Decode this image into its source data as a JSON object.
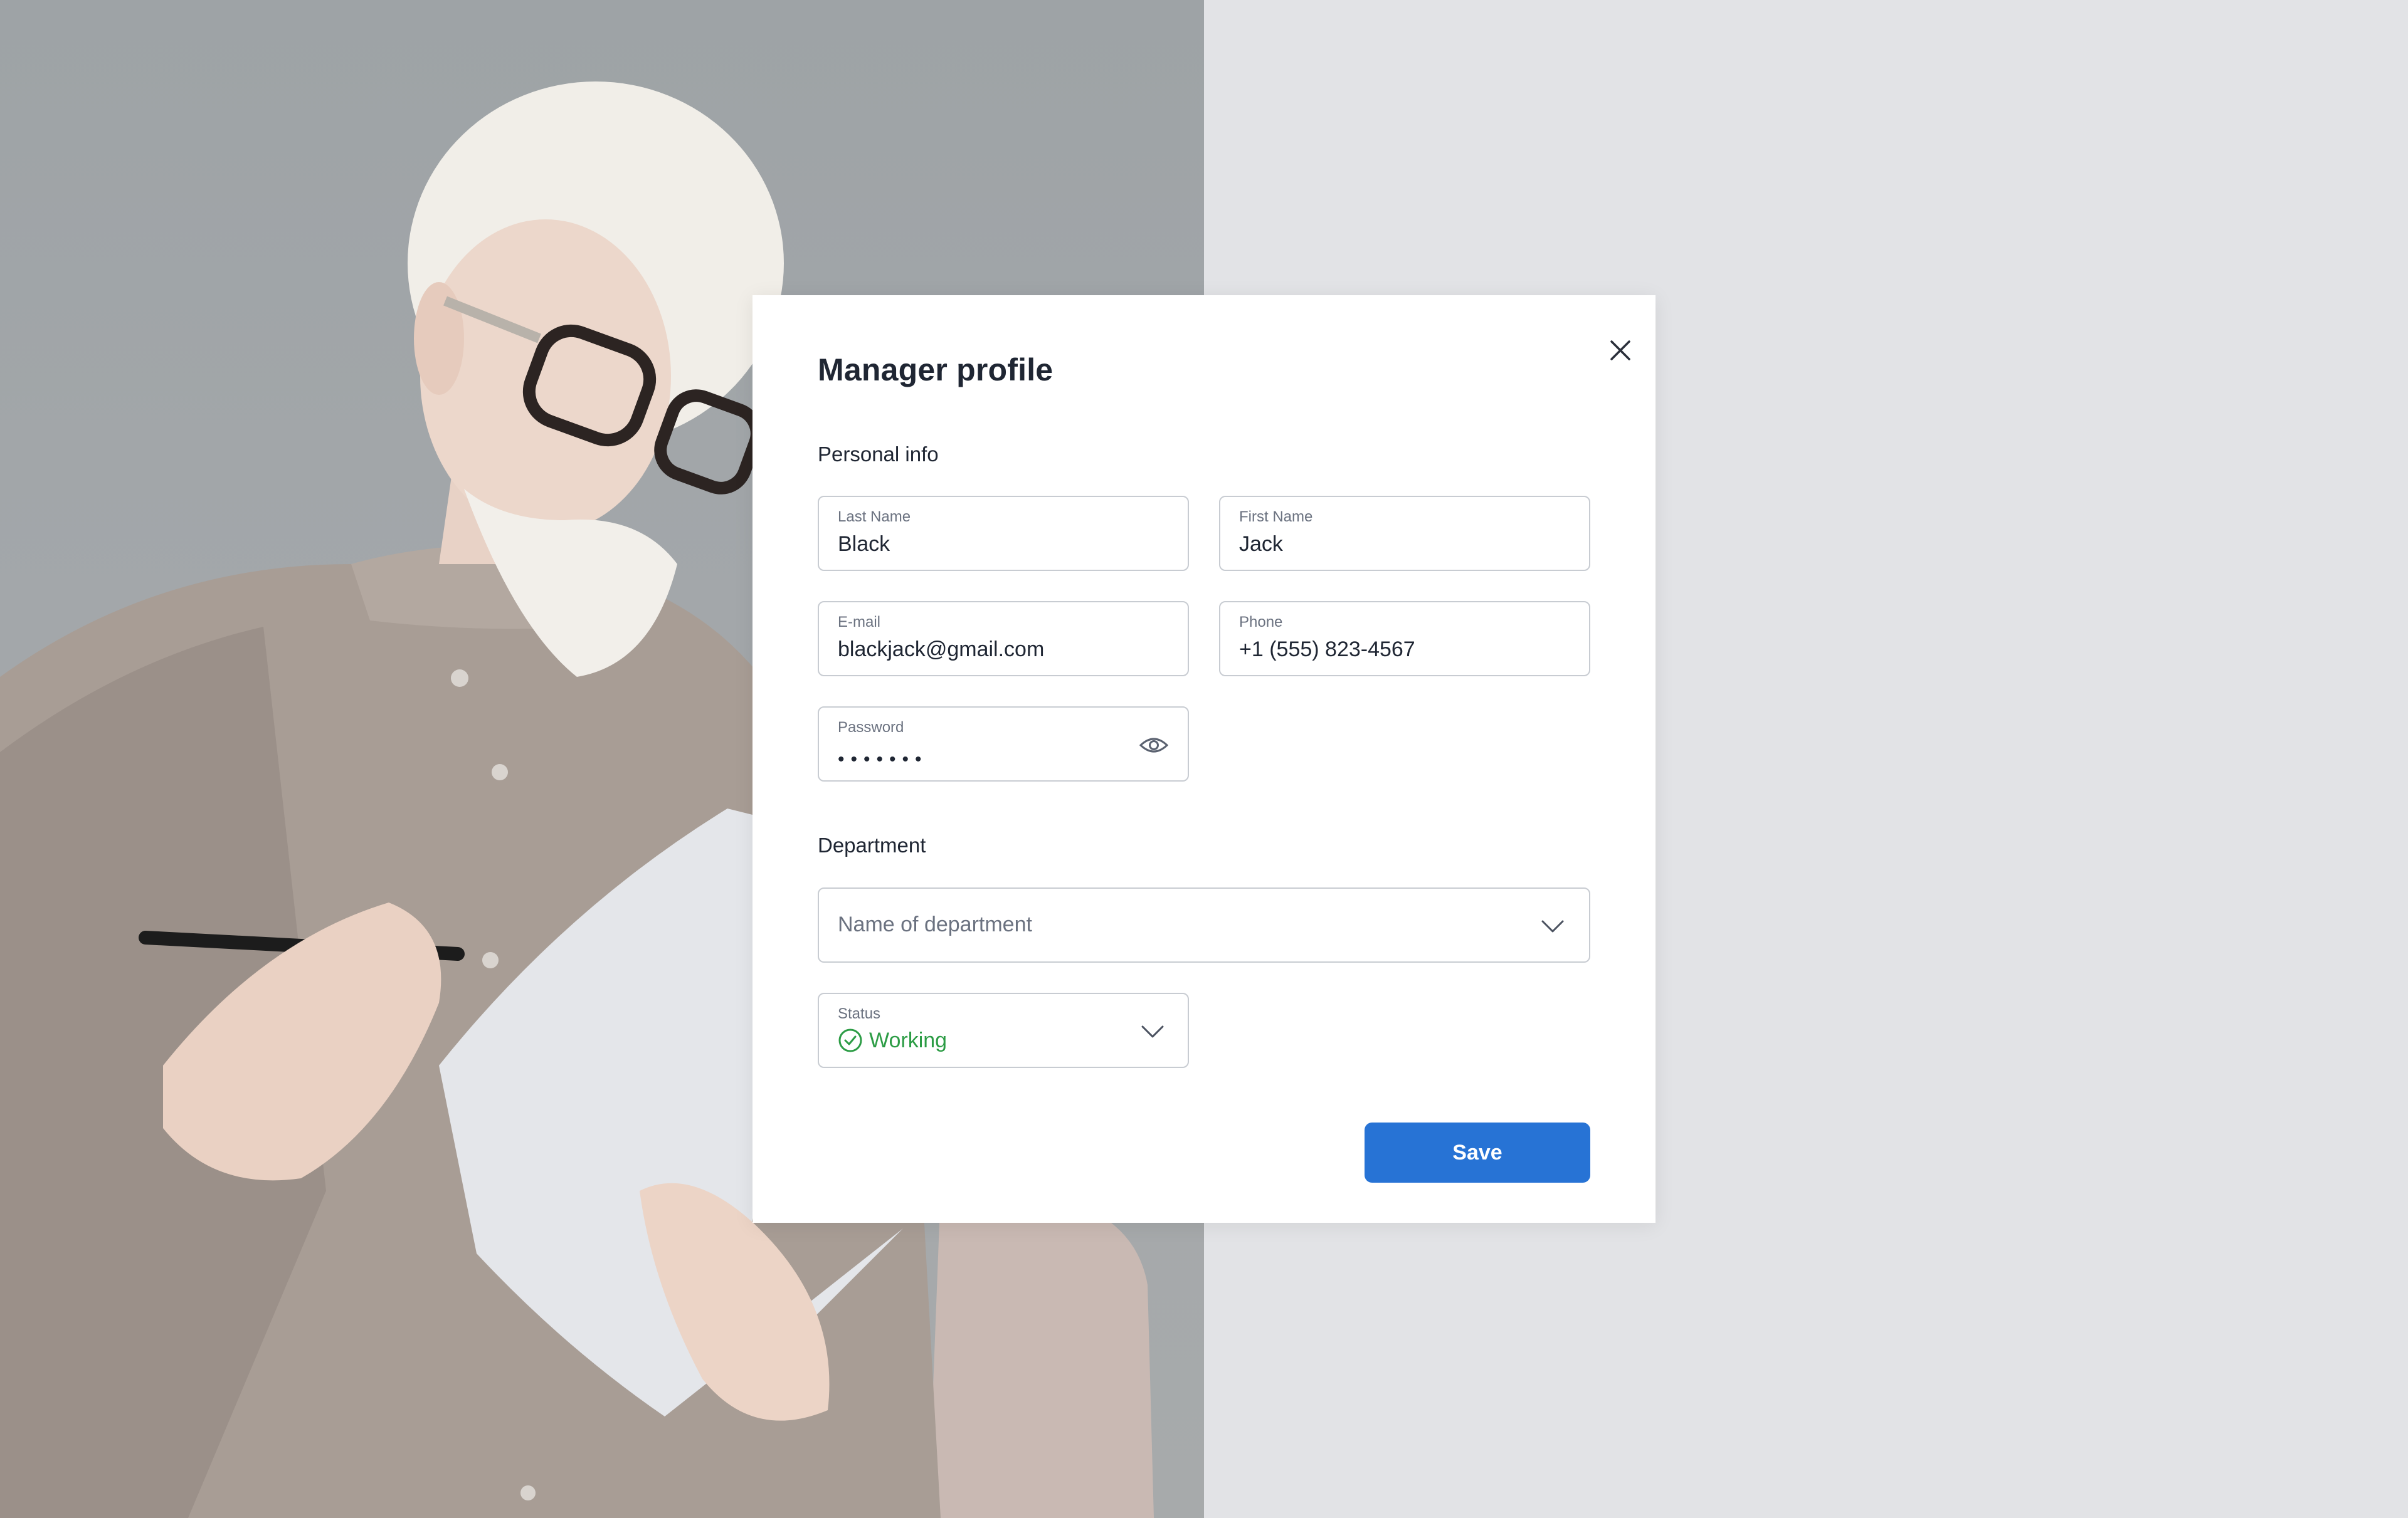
{
  "modal": {
    "title": "Manager profile",
    "close_icon": "close-icon"
  },
  "personal_info": {
    "heading": "Personal info",
    "last_name": {
      "label": "Last Name",
      "value": "Black"
    },
    "first_name": {
      "label": "First Name",
      "value": "Jack"
    },
    "email": {
      "label": "E-mail",
      "value": "blackjack@gmail.com"
    },
    "phone": {
      "label": "Phone",
      "value": "+1 (555) 823-4567"
    },
    "password": {
      "label": "Password",
      "masked_value": "•••••••",
      "toggle_icon": "eye-icon"
    }
  },
  "department": {
    "heading": "Department",
    "placeholder": "Name of department",
    "dropdown_icon": "chevron-down-icon"
  },
  "status": {
    "label": "Status",
    "value": "Working",
    "icon": "check-circle-icon",
    "dropdown_icon": "chevron-down-icon"
  },
  "actions": {
    "save_label": "Save"
  },
  "colors": {
    "primary": "#2773d5",
    "success": "#2c9c45",
    "page_background": "#e2e3e6"
  }
}
